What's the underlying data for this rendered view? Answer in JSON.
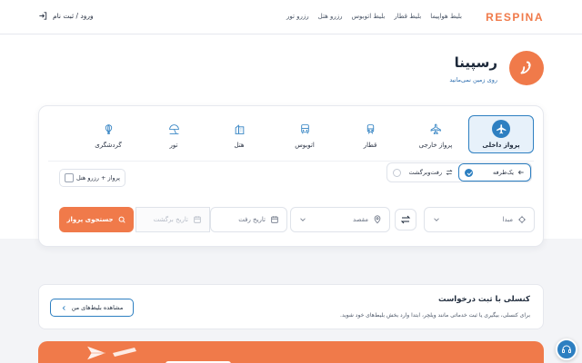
{
  "header": {
    "brand": "RESPINA",
    "nav": [
      "بلیط هواپیما",
      "بلیط قطار",
      "بلیط اتوبوس",
      "رزرو هتل",
      "رزرو تور"
    ],
    "login": "ورود / ثبت نام"
  },
  "hero": {
    "title": "رسپینا",
    "subtitle": "روی زمین نمی‌مانید"
  },
  "tabs": [
    {
      "label": "پرواز داخلی",
      "icon": "airplane-icon",
      "active": true
    },
    {
      "label": "پرواز خارجی",
      "icon": "airplane-globe-icon",
      "active": false
    },
    {
      "label": "قطار",
      "icon": "train-icon",
      "active": false
    },
    {
      "label": "اتوبوس",
      "icon": "bus-icon",
      "active": false
    },
    {
      "label": "هتل",
      "icon": "hotel-icon",
      "active": false
    },
    {
      "label": "تور",
      "icon": "beach-umbrella-icon",
      "active": false
    },
    {
      "label": "گردشگری",
      "icon": "balloon-icon",
      "active": false
    }
  ],
  "trip_type": {
    "one_way": "یک‌طرفه",
    "round_trip": "رفت‌وبرگشت",
    "selected": "one_way"
  },
  "hotel_option": "پرواز + رزرو هتل",
  "search": {
    "origin_placeholder": "مبدا",
    "destination_placeholder": "مقصد",
    "depart_placeholder": "تاریخ رفت",
    "return_placeholder": "تاریخ برگشت",
    "button": "جستجوی پرواز"
  },
  "refund": {
    "title": "کنسلی با ثبت درخواست",
    "description": "برای کنسلی، بیگیری یا ثبت خدماتی مانند ویلچر، ابتدا وارد بخش بلیط‌های خود شوید.",
    "button": "مشاهده بلیط‌های من"
  },
  "colors": {
    "brand": "#f07a4a",
    "accent": "#2d7fc1"
  }
}
